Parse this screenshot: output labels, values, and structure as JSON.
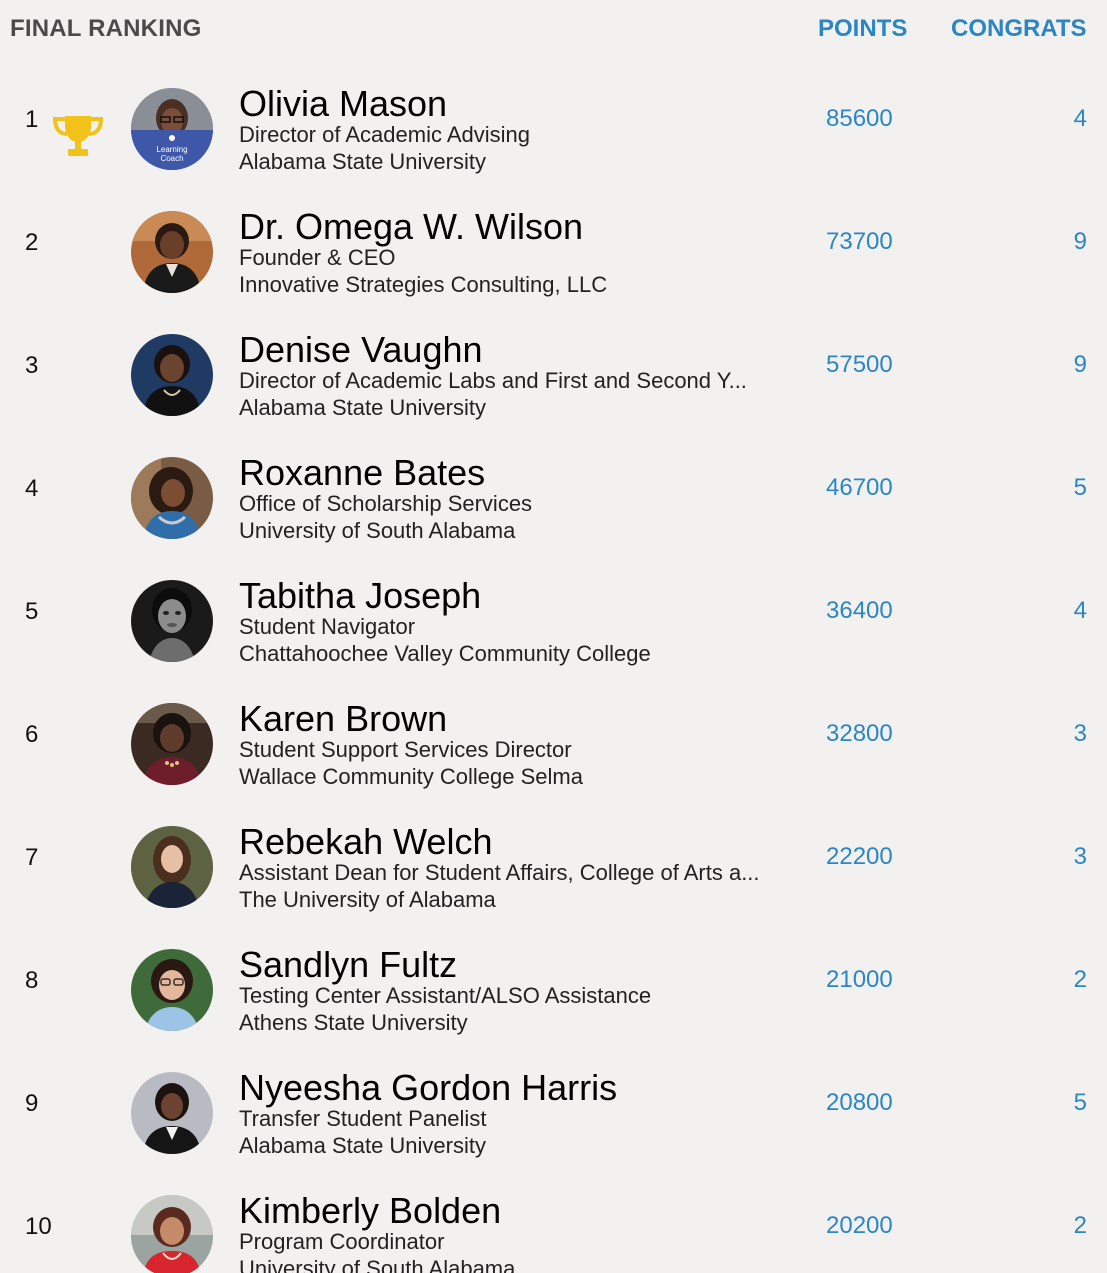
{
  "header": {
    "title": "FINAL RANKING",
    "points_label": "POINTS",
    "congrats_label": "CONGRATS"
  },
  "colors": {
    "accent": "#2a86c6",
    "background": "#f3f1ef",
    "trophy": "#f2c21a"
  },
  "rows": [
    {
      "rank": "1",
      "name": "Olivia Mason",
      "role": "Director of Academic Advising",
      "org": "Alabama State University",
      "points": "85600",
      "congrats": "4",
      "trophy": true,
      "badge_line1": "Learning",
      "badge_line2": "Coach"
    },
    {
      "rank": "2",
      "name": "Dr. Omega W. Wilson",
      "role": "Founder & CEO",
      "org": "Innovative Strategies Consulting, LLC",
      "points": "73700",
      "congrats": "9"
    },
    {
      "rank": "3",
      "name": "Denise Vaughn",
      "role": "Director of Academic Labs and First and Second Y...",
      "org": "Alabama State University",
      "points": "57500",
      "congrats": "9"
    },
    {
      "rank": "4",
      "name": "Roxanne Bates",
      "role": "Office of Scholarship Services",
      "org": "University of South Alabama",
      "points": "46700",
      "congrats": "5"
    },
    {
      "rank": "5",
      "name": "Tabitha Joseph",
      "role": "Student Navigator",
      "org": "Chattahoochee Valley Community College",
      "points": "36400",
      "congrats": "4"
    },
    {
      "rank": "6",
      "name": "Karen Brown",
      "role": "Student Support Services Director",
      "org": "Wallace Community College Selma",
      "points": "32800",
      "congrats": "3"
    },
    {
      "rank": "7",
      "name": "Rebekah Welch",
      "role": "Assistant Dean for Student Affairs, College of Arts a...",
      "org": "The University of Alabama",
      "points": "22200",
      "congrats": "3"
    },
    {
      "rank": "8",
      "name": "Sandlyn Fultz",
      "role": "Testing Center Assistant/ALSO Assistance",
      "org": "Athens State University",
      "points": "21000",
      "congrats": "2"
    },
    {
      "rank": "9",
      "name": "Nyeesha Gordon Harris",
      "role": "Transfer Student Panelist",
      "org": "Alabama State University",
      "points": "20800",
      "congrats": "5"
    },
    {
      "rank": "10",
      "name": "Kimberly Bolden",
      "role": "Program Coordinator",
      "org": "University of South Alabama",
      "points": "20200",
      "congrats": "2"
    }
  ]
}
